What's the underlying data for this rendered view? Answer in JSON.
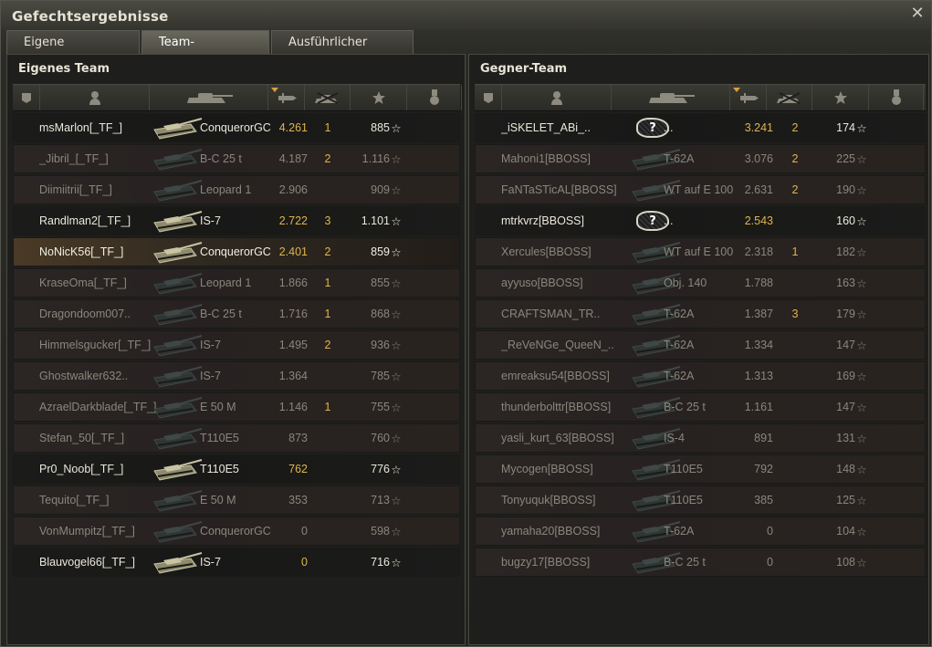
{
  "window": {
    "title": "Gefechtsergebnisse",
    "close_icon": "close-icon"
  },
  "tabs": [
    {
      "label": "Eigene Auswertung",
      "active": false
    },
    {
      "label": "Team-Auswertung",
      "active": true
    },
    {
      "label": "Ausführlicher Bericht",
      "active": false
    }
  ],
  "columns": [
    "squad-icon",
    "player-icon",
    "tank-icon",
    "damage-icon",
    "kills-icon",
    "xp-star-icon",
    "medal-icon"
  ],
  "colors": {
    "highlight": "#e0b449",
    "dead_row": "#2b2624",
    "alive_row": "#1b1b1a"
  },
  "own_team": {
    "title": "Eigenes Team",
    "rows": [
      {
        "name": "msMarlon[_TF_]",
        "tank": "ConquerorGC",
        "damage": "4.261",
        "kills": "1",
        "xp": "885",
        "state": "alive",
        "tank_color": "light"
      },
      {
        "name": "_Jibril_[_TF_]",
        "tank": "B-C 25 t",
        "damage": "4.187",
        "kills": "2",
        "xp": "1.116",
        "state": "dead",
        "tank_color": "dark"
      },
      {
        "name": "Diimiitrii[_TF_]",
        "tank": "Leopard 1",
        "damage": "2.906",
        "kills": "",
        "xp": "909",
        "state": "dead",
        "tank_color": "dark"
      },
      {
        "name": "Randlman2[_TF_]",
        "tank": "IS-7",
        "damage": "2.722",
        "kills": "3",
        "xp": "1.101",
        "state": "alive",
        "tank_color": "light"
      },
      {
        "name": "NoNicK56[_TF_]",
        "tank": "ConquerorGC",
        "damage": "2.401",
        "kills": "2",
        "xp": "859",
        "state": "player",
        "tank_color": "light"
      },
      {
        "name": "KraseOma[_TF_]",
        "tank": "Leopard 1",
        "damage": "1.866",
        "kills": "1",
        "xp": "855",
        "state": "dead",
        "tank_color": "dark"
      },
      {
        "name": "Dragondoom007..",
        "tank": "B-C 25 t",
        "damage": "1.716",
        "kills": "1",
        "xp": "868",
        "state": "dead",
        "tank_color": "dark"
      },
      {
        "name": "Himmelsgucker[_TF_]",
        "tank": "IS-7",
        "damage": "1.495",
        "kills": "2",
        "xp": "936",
        "state": "dead",
        "tank_color": "dark"
      },
      {
        "name": "Ghostwalker632..",
        "tank": "IS-7",
        "damage": "1.364",
        "kills": "",
        "xp": "785",
        "state": "dead",
        "tank_color": "dark"
      },
      {
        "name": "AzraelDarkblade[_TF_]",
        "tank": "E 50 M",
        "damage": "1.146",
        "kills": "1",
        "xp": "755",
        "state": "dead",
        "tank_color": "dark"
      },
      {
        "name": "Stefan_50[_TF_]",
        "tank": "T110E5",
        "damage": "873",
        "kills": "",
        "xp": "760",
        "state": "dead",
        "tank_color": "dark"
      },
      {
        "name": "Pr0_Noob[_TF_]",
        "tank": "T110E5",
        "damage": "762",
        "kills": "",
        "xp": "776",
        "state": "alive",
        "tank_color": "light"
      },
      {
        "name": "Tequito[_TF_]",
        "tank": "E 50 M",
        "damage": "353",
        "kills": "",
        "xp": "713",
        "state": "dead",
        "tank_color": "dark"
      },
      {
        "name": "VonMumpitz[_TF_]",
        "tank": "ConquerorGC",
        "damage": "0",
        "kills": "",
        "xp": "598",
        "state": "dead",
        "tank_color": "dark"
      },
      {
        "name": "Blauvogel66[_TF_]",
        "tank": "IS-7",
        "damage": "0",
        "kills": "",
        "xp": "716",
        "state": "alive",
        "tank_color": "light"
      }
    ]
  },
  "enemy_team": {
    "title": "Gegner-Team",
    "rows": [
      {
        "name": "_iSKELET_ABi_..",
        "tank": "...",
        "damage": "3.241",
        "kills": "2",
        "xp": "174",
        "state": "alive",
        "tank_color": "unknown"
      },
      {
        "name": "Mahoni1[BBOSS]",
        "tank": "T-62A",
        "damage": "3.076",
        "kills": "2",
        "xp": "225",
        "state": "dead",
        "tank_color": "dark"
      },
      {
        "name": "FaNTaSTicAL[BBOSS]",
        "tank": "WT auf E 100",
        "damage": "2.631",
        "kills": "2",
        "xp": "190",
        "state": "dead",
        "tank_color": "dark"
      },
      {
        "name": "mtrkvrz[BBOSS]",
        "tank": "...",
        "damage": "2.543",
        "kills": "",
        "xp": "160",
        "state": "alive",
        "tank_color": "unknown"
      },
      {
        "name": "Xercules[BBOSS]",
        "tank": "WT auf E 100",
        "damage": "2.318",
        "kills": "1",
        "xp": "182",
        "state": "dead",
        "tank_color": "dark"
      },
      {
        "name": "ayyuso[BBOSS]",
        "tank": "Obj. 140",
        "damage": "1.788",
        "kills": "",
        "xp": "163",
        "state": "dead",
        "tank_color": "dark"
      },
      {
        "name": "CRAFTSMAN_TR..",
        "tank": "T-62A",
        "damage": "1.387",
        "kills": "3",
        "xp": "179",
        "state": "dead",
        "tank_color": "dark"
      },
      {
        "name": "_ReVeNGe_QueeN_..",
        "tank": "T-62A",
        "damage": "1.334",
        "kills": "",
        "xp": "147",
        "state": "dead",
        "tank_color": "dark"
      },
      {
        "name": "emreaksu54[BBOSS]",
        "tank": "T-62A",
        "damage": "1.313",
        "kills": "",
        "xp": "169",
        "state": "dead",
        "tank_color": "dark"
      },
      {
        "name": "thunderbolttr[BBOSS]",
        "tank": "B-C 25 t",
        "damage": "1.161",
        "kills": "",
        "xp": "147",
        "state": "dead",
        "tank_color": "dark"
      },
      {
        "name": "yasli_kurt_63[BBOSS]",
        "tank": "IS-4",
        "damage": "891",
        "kills": "",
        "xp": "131",
        "state": "dead",
        "tank_color": "dark"
      },
      {
        "name": "Mycogen[BBOSS]",
        "tank": "T110E5",
        "damage": "792",
        "kills": "",
        "xp": "148",
        "state": "dead",
        "tank_color": "dark"
      },
      {
        "name": "Tonyuquk[BBOSS]",
        "tank": "T110E5",
        "damage": "385",
        "kills": "",
        "xp": "125",
        "state": "dead",
        "tank_color": "dark"
      },
      {
        "name": "yamaha20[BBOSS]",
        "tank": "T-62A",
        "damage": "0",
        "kills": "",
        "xp": "104",
        "state": "dead",
        "tank_color": "dark"
      },
      {
        "name": "bugzy17[BBOSS]",
        "tank": "B-C 25 t",
        "damage": "0",
        "kills": "",
        "xp": "108",
        "state": "dead",
        "tank_color": "dark"
      }
    ]
  }
}
